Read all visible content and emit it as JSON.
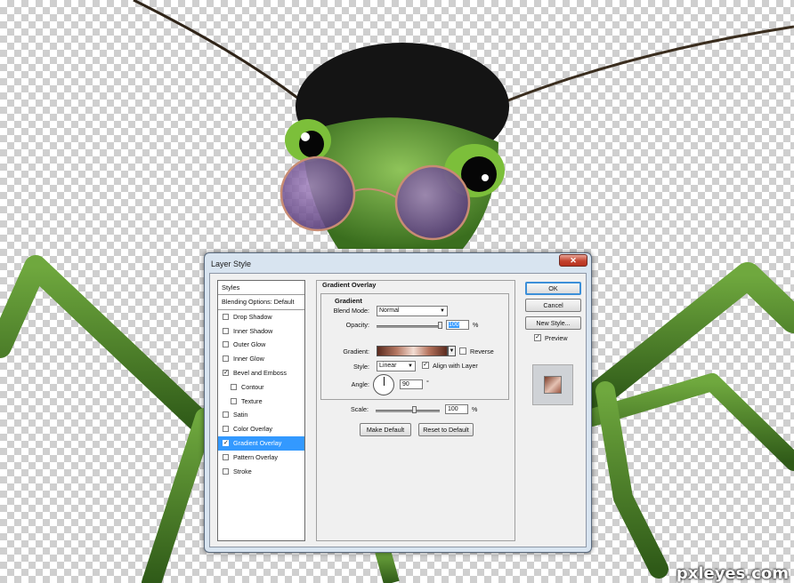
{
  "dialog": {
    "title": "Layer Style",
    "close_glyph": "✕"
  },
  "styles_list": {
    "header": "Styles",
    "blending": "Blending Options: Default",
    "items": [
      {
        "label": "Drop Shadow",
        "checked": false,
        "sub": false,
        "selected": false
      },
      {
        "label": "Inner Shadow",
        "checked": false,
        "sub": false,
        "selected": false
      },
      {
        "label": "Outer Glow",
        "checked": false,
        "sub": false,
        "selected": false
      },
      {
        "label": "Inner Glow",
        "checked": false,
        "sub": false,
        "selected": false
      },
      {
        "label": "Bevel and Emboss",
        "checked": true,
        "sub": false,
        "selected": false
      },
      {
        "label": "Contour",
        "checked": false,
        "sub": true,
        "selected": false
      },
      {
        "label": "Texture",
        "checked": false,
        "sub": true,
        "selected": false
      },
      {
        "label": "Satin",
        "checked": false,
        "sub": false,
        "selected": false
      },
      {
        "label": "Color Overlay",
        "checked": false,
        "sub": false,
        "selected": false
      },
      {
        "label": "Gradient Overlay",
        "checked": true,
        "sub": false,
        "selected": true
      },
      {
        "label": "Pattern Overlay",
        "checked": false,
        "sub": false,
        "selected": false
      },
      {
        "label": "Stroke",
        "checked": false,
        "sub": false,
        "selected": false
      }
    ]
  },
  "panel": {
    "group_title": "Gradient Overlay",
    "inner_title": "Gradient",
    "blend_mode_label": "Blend Mode:",
    "blend_mode_value": "Normal",
    "opacity_label": "Opacity:",
    "opacity_value": "100",
    "percent": "%",
    "gradient_label": "Gradient:",
    "reverse_label": "Reverse",
    "reverse_checked": false,
    "style_label": "Style:",
    "style_value": "Linear",
    "align_label": "Align with Layer",
    "align_checked": true,
    "angle_label": "Angle:",
    "angle_value": "90",
    "degree": "°",
    "scale_label": "Scale:",
    "scale_value": "100",
    "make_default": "Make Default",
    "reset_default": "Reset to Default"
  },
  "actions": {
    "ok": "OK",
    "cancel": "Cancel",
    "new_style": "New Style...",
    "preview_label": "Preview",
    "preview_checked": true
  },
  "check_glyph": "✓",
  "dropdown_glyph": "▼",
  "watermark": "pxleyes.com",
  "colors": {
    "accent_selection": "#3399ff",
    "mantis_green": "#4f8a2a",
    "lens_purple": "#7a5a9a"
  }
}
